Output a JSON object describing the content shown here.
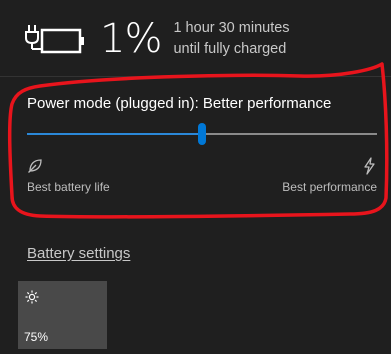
{
  "battery": {
    "icon": "battery-plug-icon",
    "percent": "1%",
    "percent_value": 1,
    "status_line1": "1 hour 30 minutes",
    "status_line2": "until fully charged"
  },
  "power_mode": {
    "title": "Power mode (plugged in): Better performance",
    "slider_value_fraction": 0.5,
    "left_icon": "leaf-icon",
    "right_icon": "lightning-bolt-icon",
    "left_label": "Best battery life",
    "right_label": "Best performance"
  },
  "links": {
    "battery_settings": "Battery settings"
  },
  "quick_actions": {
    "brightness": {
      "icon": "sun-icon",
      "label": "75%"
    }
  },
  "colors": {
    "background": "#1f1f1f",
    "accent": "#0078d7",
    "annotation": "#e8141c",
    "tile": "#494949"
  }
}
